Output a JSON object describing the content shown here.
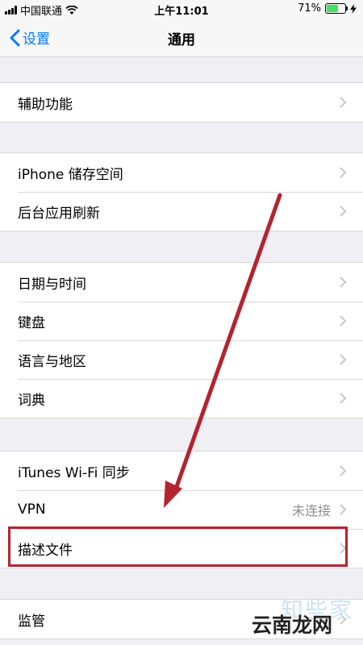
{
  "status_bar": {
    "carrier": "中国联通",
    "time": "上午11:01",
    "battery_percent": "71%",
    "battery_level": 0.71,
    "icons": [
      "signal-icon",
      "wifi-icon",
      "battery-icon",
      "charging-icon"
    ]
  },
  "nav": {
    "back_label": "设置",
    "title": "通用"
  },
  "groups": [
    {
      "items": [
        {
          "label": "辅助功能"
        }
      ]
    },
    {
      "items": [
        {
          "label": "iPhone 储存空间"
        },
        {
          "label": "后台应用刷新"
        }
      ]
    },
    {
      "items": [
        {
          "label": "日期与时间"
        },
        {
          "label": "键盘"
        },
        {
          "label": "语言与地区"
        },
        {
          "label": "词典"
        }
      ]
    },
    {
      "items": [
        {
          "label": "iTunes Wi-Fi 同步"
        },
        {
          "label": "VPN",
          "detail": "未连接"
        },
        {
          "label": "描述文件"
        }
      ]
    },
    {
      "items": [
        {
          "label": "监管"
        }
      ]
    }
  ],
  "annotation": {
    "color": "#b3242e",
    "highlighted_item": "描述文件"
  },
  "watermark": {
    "line1": "知些家",
    "line2": "云南龙网"
  },
  "colors": {
    "accent": "#007aff",
    "background": "#efeff4",
    "separator": "#d8d8dc"
  }
}
